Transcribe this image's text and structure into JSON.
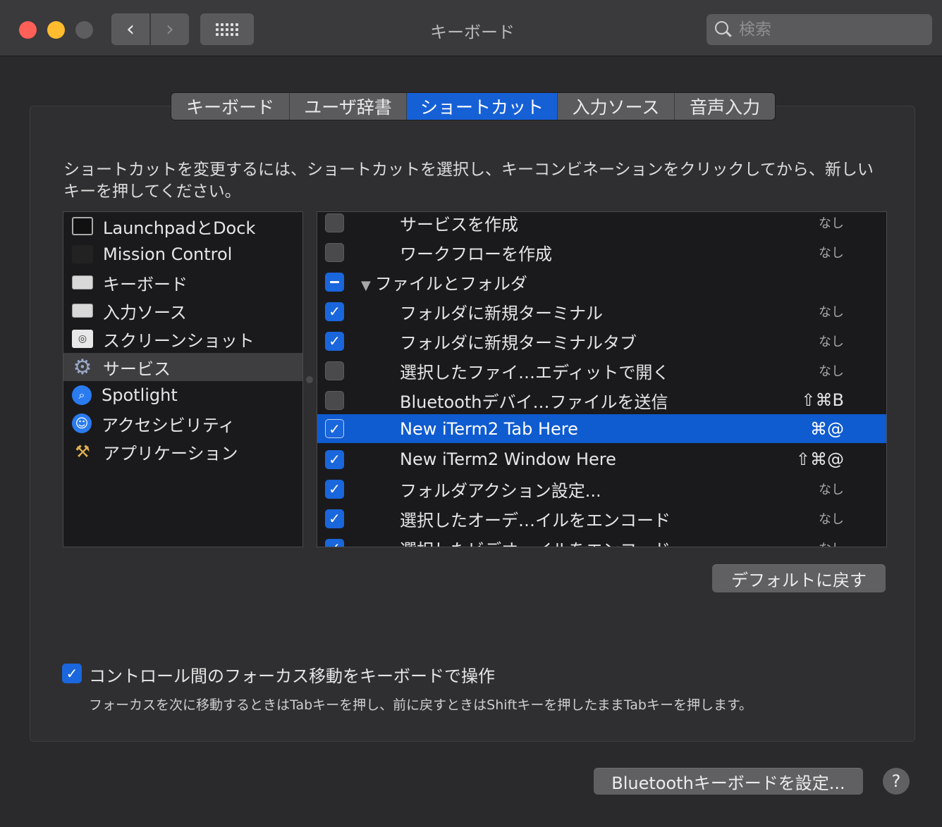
{
  "window": {
    "title": "キーボード",
    "back_glyph": "‹",
    "forward_glyph": "›"
  },
  "search": {
    "placeholder": "検索",
    "value": ""
  },
  "tabs": [
    {
      "label": "キーボード",
      "active": false
    },
    {
      "label": "ユーザ辞書",
      "active": false
    },
    {
      "label": "ショートカット",
      "active": true
    },
    {
      "label": "入力ソース",
      "active": false
    },
    {
      "label": "音声入力",
      "active": false
    }
  ],
  "description": "ショートカットを変更するには、ショートカットを選択し、キーコンビネーションをクリックしてから、新しいキーを押してください。",
  "categories": [
    {
      "label": "LaunchpadとDock",
      "icon": "launchpad-icon",
      "selected": false
    },
    {
      "label": "Mission Control",
      "icon": "mission-control-icon",
      "selected": false
    },
    {
      "label": "キーボード",
      "icon": "keyboard-icon",
      "selected": false
    },
    {
      "label": "入力ソース",
      "icon": "keyboard-icon",
      "selected": false
    },
    {
      "label": "スクリーンショット",
      "icon": "screenshot-icon",
      "selected": false
    },
    {
      "label": "サービス",
      "icon": "gear-icon",
      "selected": true
    },
    {
      "label": "Spotlight",
      "icon": "spotlight-icon",
      "selected": false
    },
    {
      "label": "アクセシビリティ",
      "icon": "accessibility-icon",
      "selected": false
    },
    {
      "label": "アプリケーション",
      "icon": "app-store-icon",
      "selected": false
    }
  ],
  "shortcuts": [
    {
      "label": "サービスを作成",
      "checked": "off",
      "shortcut": "なし",
      "group": false
    },
    {
      "label": "ワークフローを作成",
      "checked": "off",
      "shortcut": "なし",
      "group": false
    },
    {
      "label": "ファイルとフォルダ",
      "checked": "mixed",
      "shortcut": "",
      "group": true,
      "disclosure": "▼"
    },
    {
      "label": "フォルダに新規ターミナル",
      "checked": "on",
      "shortcut": "なし",
      "group": false
    },
    {
      "label": "フォルダに新規ターミナルタブ",
      "checked": "on",
      "shortcut": "なし",
      "group": false
    },
    {
      "label": "選択したファイ…エディットで開く",
      "checked": "off",
      "shortcut": "なし",
      "group": false
    },
    {
      "label": "Bluetoothデバイ…ファイルを送信",
      "checked": "off",
      "shortcut": "⇧⌘B",
      "group": false
    },
    {
      "label": "New iTerm2 Tab Here",
      "checked": "on",
      "shortcut": "⌘@",
      "group": false,
      "selected": true
    },
    {
      "label": "New iTerm2 Window Here",
      "checked": "on",
      "shortcut": "⇧⌘@",
      "group": false
    },
    {
      "label": "フォルダアクション設定...",
      "checked": "on",
      "shortcut": "なし",
      "group": false
    },
    {
      "label": "選択したオーデ…イルをエンコード",
      "checked": "on",
      "shortcut": "なし",
      "group": false
    },
    {
      "label": "選択したビデオ…イルをエンコード",
      "checked": "on",
      "shortcut": "なし",
      "group": false
    }
  ],
  "restore_defaults_label": "デフォルトに戻す",
  "focus": {
    "label": "コントロール間のフォーカス移動をキーボードで操作",
    "checked": true,
    "hint": "フォーカスを次に移動するときはTabキーを押し、前に戻すときはShiftキーを押したままTabキーを押します。"
  },
  "bluetooth_button_label": "Bluetoothキーボードを設定...",
  "help_label": "?",
  "colors": {
    "accent": "#1660d6",
    "close": "#fe5f57",
    "minimize": "#febc2e"
  }
}
